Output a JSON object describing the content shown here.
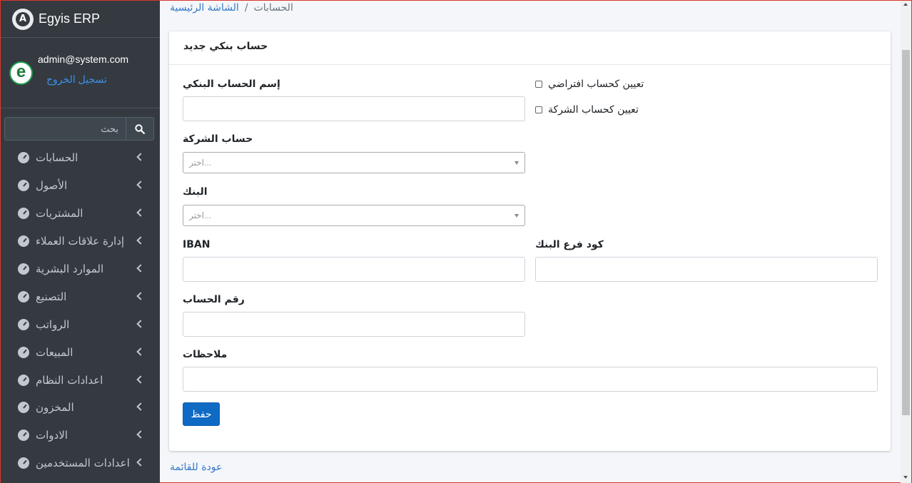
{
  "app": {
    "title": "Egyis ERP"
  },
  "user": {
    "email": "admin@system.com",
    "logout": "تسجيل الخروج"
  },
  "search": {
    "placeholder": "بحث"
  },
  "sidebar": {
    "items": [
      {
        "label": "الحسابات"
      },
      {
        "label": "الأصول"
      },
      {
        "label": "المشتريات"
      },
      {
        "label": "إدارة علاقات العملاء"
      },
      {
        "label": "الموارد البشرية"
      },
      {
        "label": "التصنيع"
      },
      {
        "label": "الرواتب"
      },
      {
        "label": "المبيعات"
      },
      {
        "label": "اعدادات النظام"
      },
      {
        "label": "المخزون"
      },
      {
        "label": "الادوات"
      },
      {
        "label": "اعدادات المستخدمين"
      }
    ]
  },
  "breadcrumb": {
    "home": "الشاشة الرئيسية",
    "separator": "/",
    "current": "الحسابات"
  },
  "form": {
    "title": "حساب بنكي جديد",
    "bank_account_name_label": "إسم الحساب البنكي",
    "default_checkbox_label": "تعيين كحساب افتراضي",
    "company_checkbox_label": "تعيين كحساب الشركة",
    "company_account_label": "حساب الشركة",
    "company_account_placeholder": "اختر...",
    "bank_label": "البنك",
    "bank_placeholder": "اختر...",
    "iban_label": "IBAN",
    "branch_code_label": "كود فرع البنك",
    "account_number_label": "رقم الحساب",
    "notes_label": "ملاحظات",
    "save_label": "حفظ"
  },
  "footer": {
    "back_link": "عودة للقائمة"
  },
  "colors": {
    "sidebar": "#343a40",
    "accent": "#0f6ac4",
    "link": "#3478c6"
  }
}
